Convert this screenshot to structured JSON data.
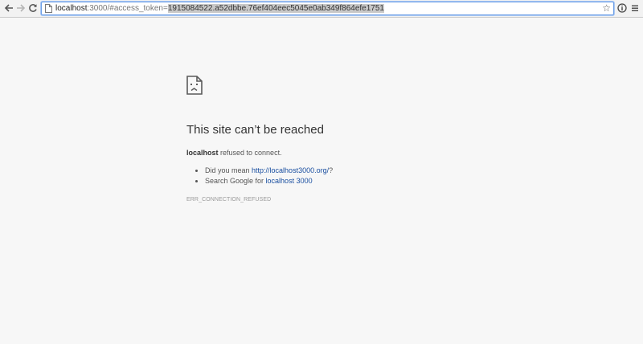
{
  "browser": {
    "url_host": "localhost",
    "url_path": ":3000/#access_token=",
    "url_selected": "1915084522.a52dbbe.76ef404eec5045e0ab349f864efe1751",
    "back_icon": "back-arrow-icon",
    "forward_icon": "forward-arrow-icon",
    "reload_icon": "reload-icon",
    "bookmark_icon": "star-icon",
    "info_icon": "info-icon",
    "menu_icon": "menu-icon"
  },
  "error_page": {
    "icon": "sad-page-icon",
    "title": "This site can’t be reached",
    "host": "localhost",
    "message": " refused to connect.",
    "suggestions": [
      {
        "prefix": "Did you mean ",
        "link": "http://localhost3000.org/",
        "suffix": "?"
      },
      {
        "prefix": "Search Google for ",
        "link": "localhost 3000",
        "suffix": ""
      }
    ],
    "error_code": "ERR_CONNECTION_REFUSED"
  },
  "colors": {
    "page_background": "#f7f7f7",
    "link": "#1a4fa0",
    "omnibox_focus": "#6d9fe6"
  }
}
